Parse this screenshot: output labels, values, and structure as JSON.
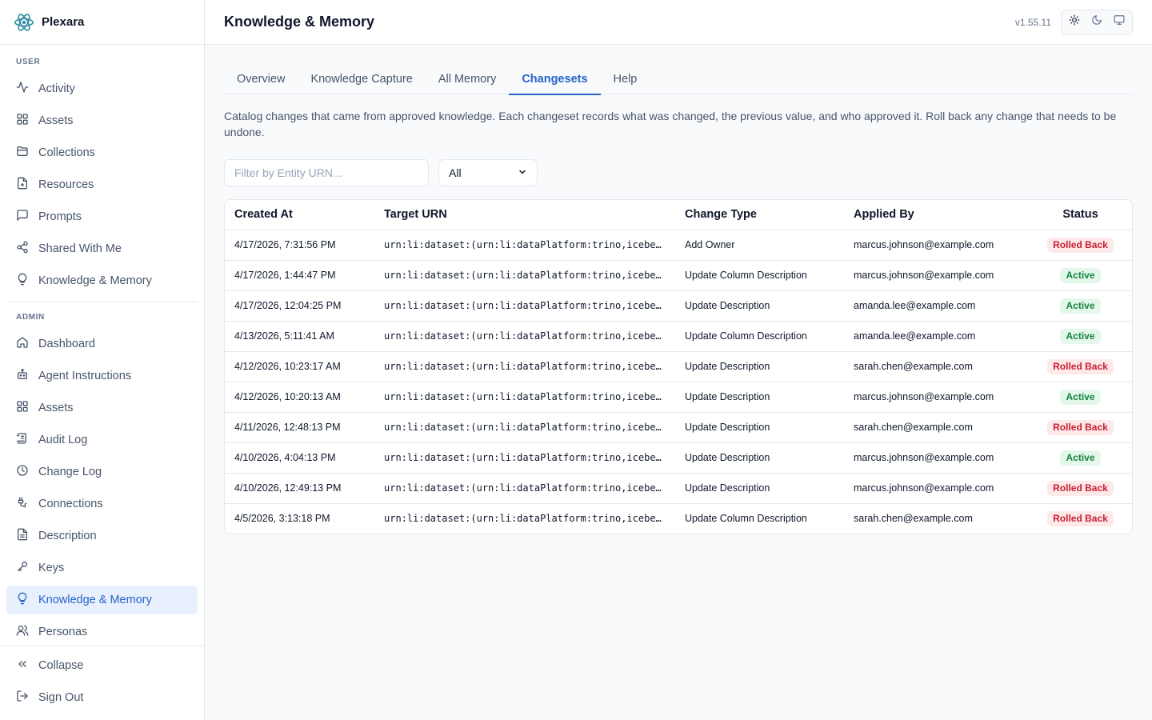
{
  "app": {
    "name": "Plexara",
    "version": "v1.55.11"
  },
  "sidebar": {
    "user_section": "USER",
    "user_items": [
      {
        "label": "Activity",
        "icon": "activity-icon"
      },
      {
        "label": "Assets",
        "icon": "grid-icon"
      },
      {
        "label": "Collections",
        "icon": "folder-icon"
      },
      {
        "label": "Resources",
        "icon": "file-icon"
      },
      {
        "label": "Prompts",
        "icon": "message-icon"
      },
      {
        "label": "Shared With Me",
        "icon": "share-icon"
      },
      {
        "label": "Knowledge & Memory",
        "icon": "lightbulb-icon"
      }
    ],
    "admin_section": "ADMIN",
    "admin_items": [
      {
        "label": "Dashboard",
        "icon": "home-icon"
      },
      {
        "label": "Agent Instructions",
        "icon": "bot-icon"
      },
      {
        "label": "Assets",
        "icon": "grid-icon"
      },
      {
        "label": "Audit Log",
        "icon": "scroll-icon"
      },
      {
        "label": "Change Log",
        "icon": "clock-icon"
      },
      {
        "label": "Connections",
        "icon": "plug-icon"
      },
      {
        "label": "Description",
        "icon": "doc-icon"
      },
      {
        "label": "Keys",
        "icon": "key-icon"
      },
      {
        "label": "Knowledge & Memory",
        "icon": "lightbulb-icon",
        "active": true
      },
      {
        "label": "Personas",
        "icon": "users-icon"
      }
    ],
    "footer": {
      "collapse_label": "Collapse",
      "signout_label": "Sign Out"
    }
  },
  "header": {
    "title": "Knowledge & Memory"
  },
  "tabs": [
    {
      "label": "Overview"
    },
    {
      "label": "Knowledge Capture"
    },
    {
      "label": "All Memory"
    },
    {
      "label": "Changesets",
      "active": true
    },
    {
      "label": "Help"
    }
  ],
  "description": "Catalog changes that came from approved knowledge. Each changeset records what was changed, the previous value, and who approved it. Roll back any change that needs to be undone.",
  "filters": {
    "urn_placeholder": "Filter by Entity URN...",
    "status_value": "All"
  },
  "table": {
    "columns": [
      "Created At",
      "Target URN",
      "Change Type",
      "Applied By",
      "Status"
    ],
    "rows": [
      {
        "created_at": "4/17/2026, 7:31:56 PM",
        "urn": "urn:li:dataset:(urn:li:dataPlatform:trino,icebe…",
        "change_type": "Add Owner",
        "applied_by": "marcus.johnson@example.com",
        "status": "Rolled Back"
      },
      {
        "created_at": "4/17/2026, 1:44:47 PM",
        "urn": "urn:li:dataset:(urn:li:dataPlatform:trino,icebe…",
        "change_type": "Update Column Description",
        "applied_by": "marcus.johnson@example.com",
        "status": "Active"
      },
      {
        "created_at": "4/17/2026, 12:04:25 PM",
        "urn": "urn:li:dataset:(urn:li:dataPlatform:trino,icebe…",
        "change_type": "Update Description",
        "applied_by": "amanda.lee@example.com",
        "status": "Active"
      },
      {
        "created_at": "4/13/2026, 5:11:41 AM",
        "urn": "urn:li:dataset:(urn:li:dataPlatform:trino,icebe…",
        "change_type": "Update Column Description",
        "applied_by": "amanda.lee@example.com",
        "status": "Active"
      },
      {
        "created_at": "4/12/2026, 10:23:17 AM",
        "urn": "urn:li:dataset:(urn:li:dataPlatform:trino,icebe…",
        "change_type": "Update Description",
        "applied_by": "sarah.chen@example.com",
        "status": "Rolled Back"
      },
      {
        "created_at": "4/12/2026, 10:20:13 AM",
        "urn": "urn:li:dataset:(urn:li:dataPlatform:trino,icebe…",
        "change_type": "Update Description",
        "applied_by": "marcus.johnson@example.com",
        "status": "Active"
      },
      {
        "created_at": "4/11/2026, 12:48:13 PM",
        "urn": "urn:li:dataset:(urn:li:dataPlatform:trino,icebe…",
        "change_type": "Update Description",
        "applied_by": "sarah.chen@example.com",
        "status": "Rolled Back"
      },
      {
        "created_at": "4/10/2026, 4:04:13 PM",
        "urn": "urn:li:dataset:(urn:li:dataPlatform:trino,icebe…",
        "change_type": "Update Description",
        "applied_by": "marcus.johnson@example.com",
        "status": "Active"
      },
      {
        "created_at": "4/10/2026, 12:49:13 PM",
        "urn": "urn:li:dataset:(urn:li:dataPlatform:trino,icebe…",
        "change_type": "Update Description",
        "applied_by": "marcus.johnson@example.com",
        "status": "Rolled Back"
      },
      {
        "created_at": "4/5/2026, 3:13:18 PM",
        "urn": "urn:li:dataset:(urn:li:dataPlatform:trino,icebe…",
        "change_type": "Update Column Description",
        "applied_by": "sarah.chen@example.com",
        "status": "Rolled Back"
      }
    ]
  },
  "colors": {
    "accent": "#2563c9",
    "rolled_back_bg": "#fde8ea",
    "rolled_back_text": "#c8202e",
    "active_bg": "#e3f7ea",
    "active_text": "#16843f"
  }
}
